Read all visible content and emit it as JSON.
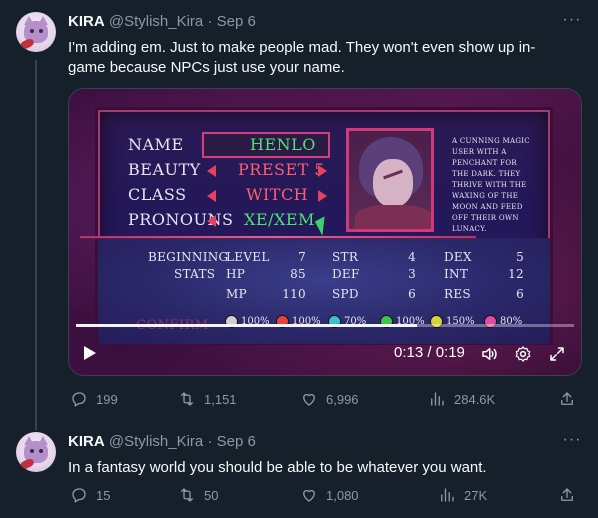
{
  "tweets": [
    {
      "name": "KIRA",
      "handle": "@Stylish_Kira",
      "separator": "·",
      "date": "Sep 6",
      "more": "···",
      "text": "I'm adding em. Just to make people mad. They won't even show up in-game because NPCs just use your name.",
      "media": {
        "game": {
          "rows": [
            {
              "label": "NAME",
              "value": "HENLO"
            },
            {
              "label": "BEAUTY",
              "value": "PRESET 5"
            },
            {
              "label": "CLASS",
              "value": "WITCH"
            },
            {
              "label": "PRONOUNS",
              "value": "XE/XEM"
            }
          ],
          "bio": "A CUNNING MAGIC USER WITH A PENCHANT FOR THE DARK. THEY THRIVE WITH THE WAXING OF THE MOON AND FEED OFF THEIR OWN LUNACY.",
          "stats_title_1": "BEGINNING",
          "stats_title_2": "STATS",
          "stats": [
            {
              "label": "LEVEL",
              "value": "7"
            },
            {
              "label": "HP",
              "value": "85"
            },
            {
              "label": "MP",
              "value": "110"
            },
            {
              "label": "STR",
              "value": "4"
            },
            {
              "label": "DEF",
              "value": "3"
            },
            {
              "label": "SPD",
              "value": "6"
            },
            {
              "label": "DEX",
              "value": "5"
            },
            {
              "label": "INT",
              "value": "12"
            },
            {
              "label": "RES",
              "value": "6"
            }
          ],
          "confirm": "CONFIRM",
          "affinities": [
            {
              "value": "100%",
              "color": "#cfcfcf"
            },
            {
              "value": "100%",
              "color": "#e8413e"
            },
            {
              "value": "70%",
              "color": "#39c0c8"
            },
            {
              "value": "100%",
              "color": "#3ec64b"
            },
            {
              "value": "150%",
              "color": "#d6d43a"
            },
            {
              "value": "80%",
              "color": "#e04ca2"
            }
          ]
        },
        "player": {
          "time": "0:13 / 0:19",
          "progress": 0.684
        }
      },
      "actions": {
        "reply": "199",
        "retweet": "1,151",
        "like": "6,996",
        "views": "284.6K"
      }
    },
    {
      "name": "KIRA",
      "handle": "@Stylish_Kira",
      "separator": "·",
      "date": "Sep 6",
      "more": "···",
      "text": "In a fantasy world you should be able to be whatever you want.",
      "actions": {
        "reply": "15",
        "retweet": "50",
        "like": "1,080",
        "views": "27K"
      }
    }
  ],
  "colors": {
    "background": "#15202b",
    "text_primary": "#f7f9f9",
    "text_secondary": "#8b98a5",
    "thread_line": "#38444d"
  }
}
